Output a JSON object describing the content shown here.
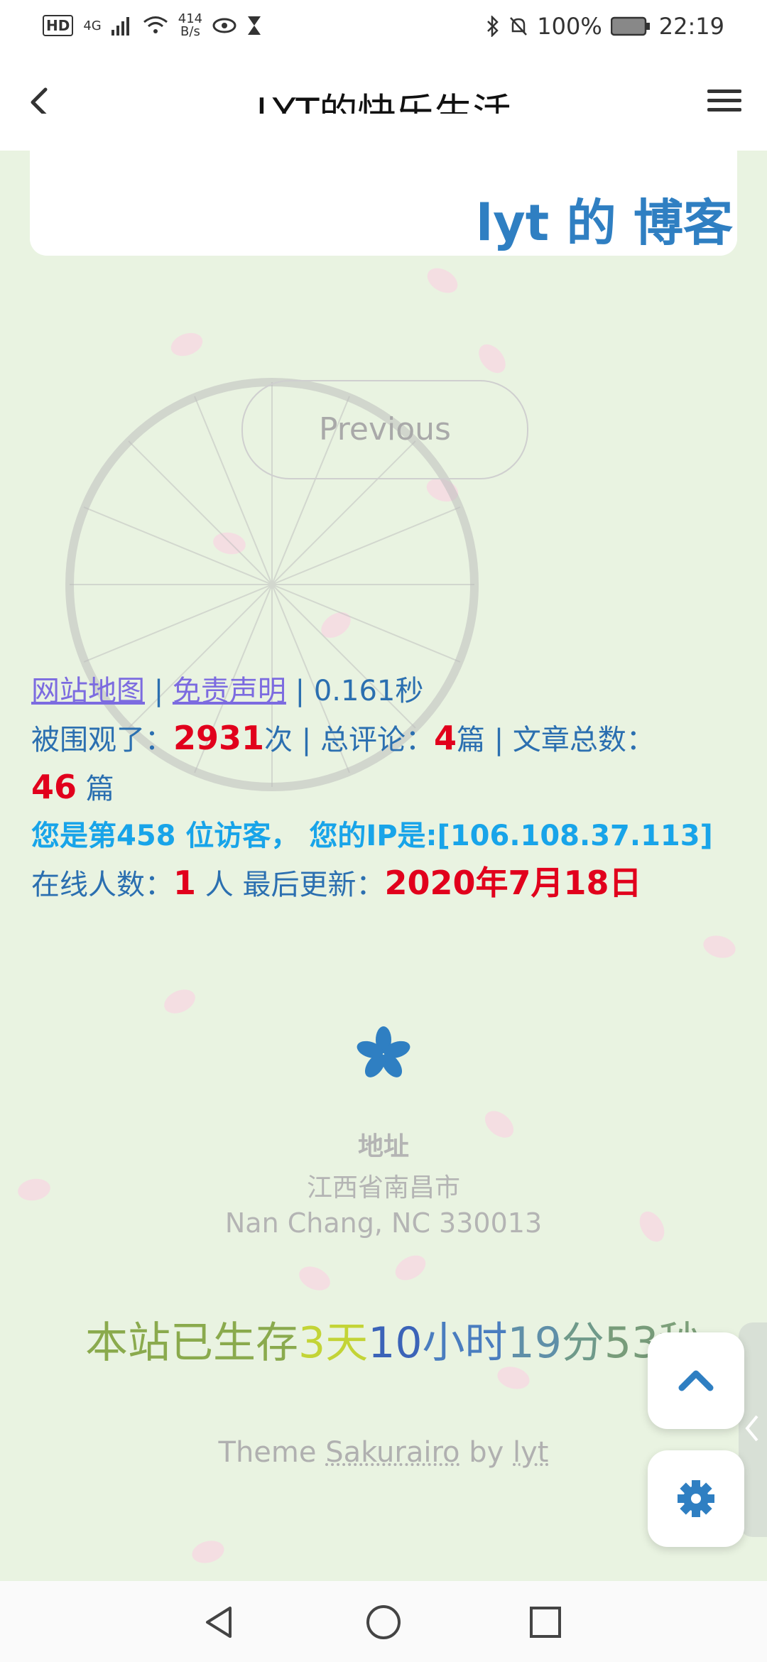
{
  "status": {
    "left_network": "4G",
    "speed_value": "414",
    "speed_unit": "B/s",
    "battery": "100%",
    "time": "22:19"
  },
  "appbar": {
    "title": "LYT的快乐生活"
  },
  "card": {
    "blog_label": "lyt 的 博客"
  },
  "pager": {
    "previous_label": "Previous"
  },
  "footer": {
    "sitemap_link": "网站地图",
    "disclaimer_link": "免责声明",
    "load_time": "0.161秒",
    "views_label": "被围观了：",
    "views_count": "2931",
    "views_unit": "次",
    "comments_label": "总评论：",
    "comments_count": "4",
    "comments_unit": "篇",
    "posts_label": "文章总数：",
    "posts_count": "46",
    "posts_unit": " 篇",
    "visitor_text": "您是第458 位访客， 您的IP是:[106.108.37.113]",
    "online_label": "在线人数：",
    "online_count": "1",
    "online_unit": " 人 ",
    "updated_label": "最后更新：",
    "updated_date": "2020年7月18日"
  },
  "address": {
    "heading": "地址",
    "line1": "江西省南昌市",
    "line2": "Nan Chang, NC 330013"
  },
  "uptime": {
    "prefix": "本站已生存",
    "days": "3",
    "days_unit": "天",
    "hours": "10",
    "hours_unit": "小时",
    "minutes": "19",
    "minutes_unit": "分",
    "seconds": "53",
    "seconds_unit": "秒"
  },
  "theme_credit": {
    "prefix": "Theme ",
    "theme_name": "Sakurairo",
    "mid": " by ",
    "author": "lyt"
  },
  "colors": {
    "accent_blue": "#2f7fc2",
    "red": "#e1001c",
    "cyan": "#18a4e9",
    "link_purple": "#7c6be0",
    "background": "#e9f3e1"
  },
  "icons": {
    "back": "chevron-left-icon",
    "menu": "hamburger-icon",
    "scroll_top": "chevron-up-icon",
    "settings": "gear-icon",
    "flower": "sakura-flower-icon"
  }
}
